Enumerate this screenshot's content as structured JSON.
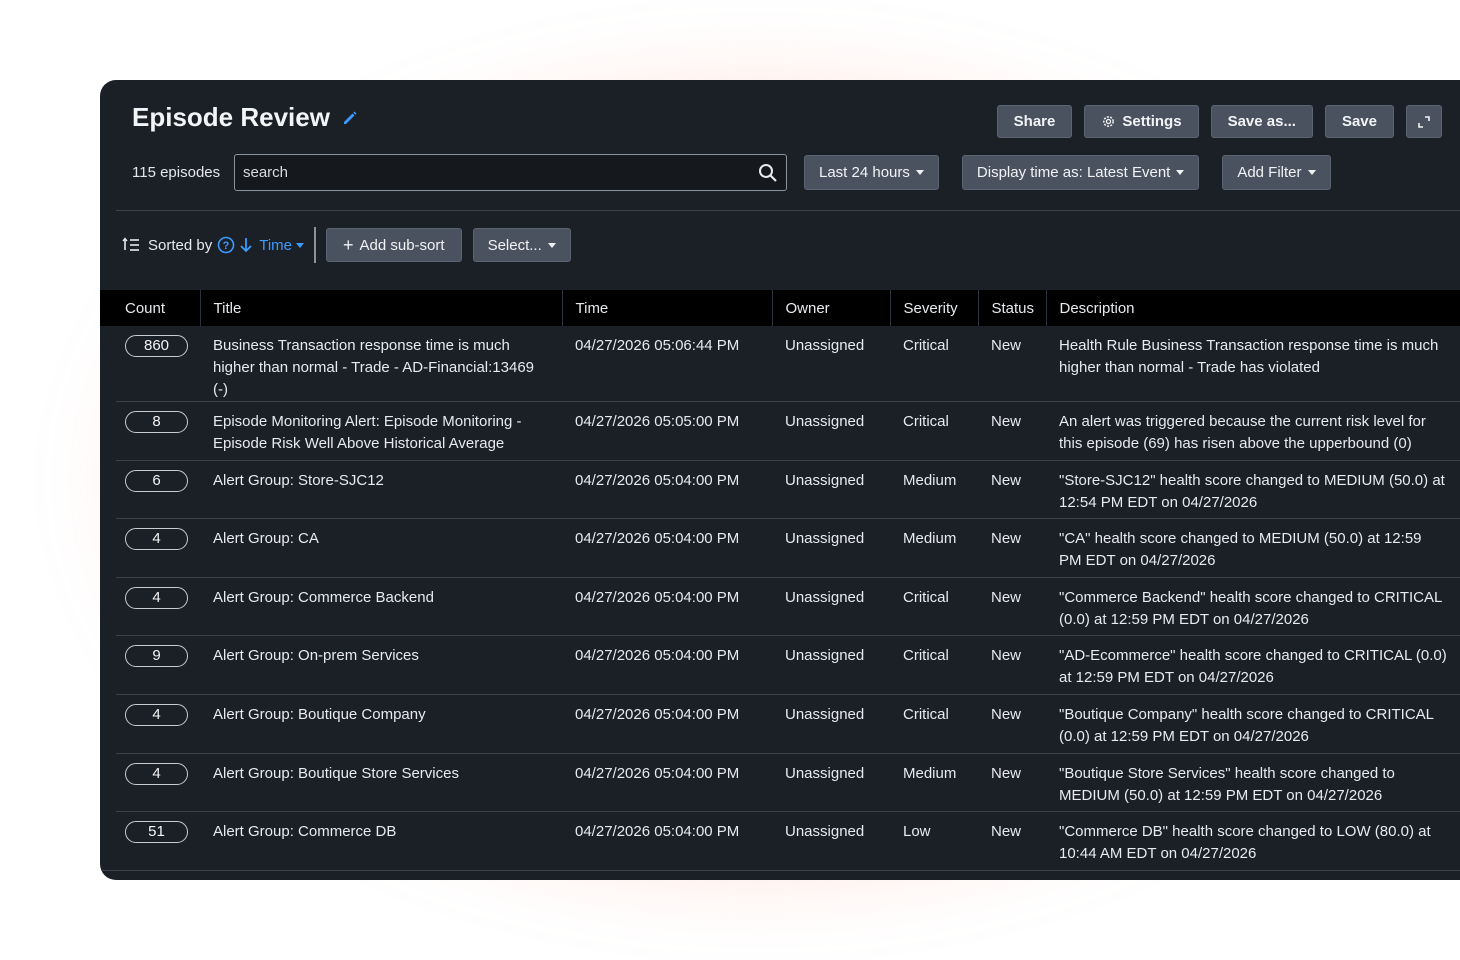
{
  "header": {
    "title": "Episode Review",
    "buttons": {
      "share": "Share",
      "settings": "Settings",
      "save_as": "Save as...",
      "save": "Save"
    }
  },
  "toolbar": {
    "episode_count": "115 episodes",
    "search_value": "search",
    "time_range": "Last 24 hours",
    "display_time": "Display time as: Latest Event",
    "add_filter": "Add Filter"
  },
  "sort": {
    "label": "Sorted by",
    "field": "Time",
    "add_sub_sort": "Add sub-sort",
    "select": "Select..."
  },
  "table": {
    "columns": [
      "Count",
      "Title",
      "Time",
      "Owner",
      "Severity",
      "Status",
      "Description"
    ],
    "rows": [
      {
        "count": "860",
        "title": "Business Transaction response time is much higher than normal - Trade - AD-Financial:13469 (-)",
        "time": "04/27/2026 05:06:44 PM",
        "owner": "Unassigned",
        "severity": "Critical",
        "status": "New",
        "description": "Health Rule Business Transaction response time is much higher than normal - Trade has violated"
      },
      {
        "count": "8",
        "title": "Episode Monitoring Alert: Episode Monitoring - Episode Risk Well Above Historical Average",
        "time": "04/27/2026 05:05:00 PM",
        "owner": "Unassigned",
        "severity": "Critical",
        "status": "New",
        "description": "An alert was triggered because the current risk level for this episode (69) has risen above the upperbound (0)"
      },
      {
        "count": "6",
        "title": "Alert Group: Store-SJC12",
        "time": "04/27/2026 05:04:00 PM",
        "owner": "Unassigned",
        "severity": "Medium",
        "status": "New",
        "description": "\"Store-SJC12\" health score changed to MEDIUM (50.0) at 12:54 PM EDT on 04/27/2026"
      },
      {
        "count": "4",
        "title": "Alert Group: CA",
        "time": "04/27/2026 05:04:00 PM",
        "owner": "Unassigned",
        "severity": "Medium",
        "status": "New",
        "description": "\"CA\" health score changed to MEDIUM (50.0) at 12:59 PM EDT on 04/27/2026"
      },
      {
        "count": "4",
        "title": "Alert Group: Commerce Backend",
        "time": "04/27/2026 05:04:00 PM",
        "owner": "Unassigned",
        "severity": "Critical",
        "status": "New",
        "description": "\"Commerce Backend\" health score changed to CRITICAL (0.0) at 12:59 PM EDT on 04/27/2026"
      },
      {
        "count": "9",
        "title": "Alert Group: On-prem Services",
        "time": "04/27/2026 05:04:00 PM",
        "owner": "Unassigned",
        "severity": "Critical",
        "status": "New",
        "description": "\"AD-Ecommerce\" health score changed to CRITICAL (0.0) at 12:59 PM EDT on 04/27/2026"
      },
      {
        "count": "4",
        "title": "Alert Group: Boutique Company",
        "time": "04/27/2026 05:04:00 PM",
        "owner": "Unassigned",
        "severity": "Critical",
        "status": "New",
        "description": "\"Boutique Company\" health score changed to CRITICAL (0.0) at 12:59 PM EDT on 04/27/2026"
      },
      {
        "count": "4",
        "title": "Alert Group: Boutique Store Services",
        "time": "04/27/2026 05:04:00 PM",
        "owner": "Unassigned",
        "severity": "Medium",
        "status": "New",
        "description": "\"Boutique Store Services\" health score changed to MEDIUM (50.0) at 12:59 PM EDT on 04/27/2026"
      },
      {
        "count": "51",
        "title": "Alert Group: Commerce DB",
        "time": "04/27/2026 05:04:00 PM",
        "owner": "Unassigned",
        "severity": "Low",
        "status": "New",
        "description": "\"Commerce DB\" health score changed to LOW (80.0) at 10:44 AM EDT on 04/27/2026"
      }
    ]
  },
  "colors": {
    "panel_bg": "#1b1f26",
    "header_row_bg": "#000000",
    "accent": "#3b9bff",
    "button_bg": "#4a5260"
  }
}
